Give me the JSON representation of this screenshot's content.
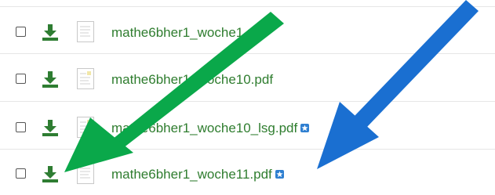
{
  "files": [
    {
      "name": "mathe6bher1_woche1.pdf",
      "badge": false,
      "doc_icon": "pdf-document-icon"
    },
    {
      "name": "mathe6bher1_woche10.pdf",
      "badge": false,
      "doc_icon": "pdf-document-icon"
    },
    {
      "name": "mathe6bher1_woche10_lsg.pdf",
      "badge": true,
      "doc_icon": "pdf-document-icon"
    },
    {
      "name": "mathe6bher1_woche11.pdf",
      "badge": true,
      "doc_icon": "pdf-document-icon"
    }
  ],
  "icons": {
    "download": "download-icon",
    "document": "document-icon",
    "new_badge": "new-badge-icon"
  },
  "colors": {
    "link_green": "#2f7d2f",
    "download_green": "#2e7d32",
    "arrow_green": "#0aa84a",
    "arrow_blue": "#1a6fd1",
    "badge_blue": "#2f7fd1",
    "divider": "#e6e6e6"
  }
}
